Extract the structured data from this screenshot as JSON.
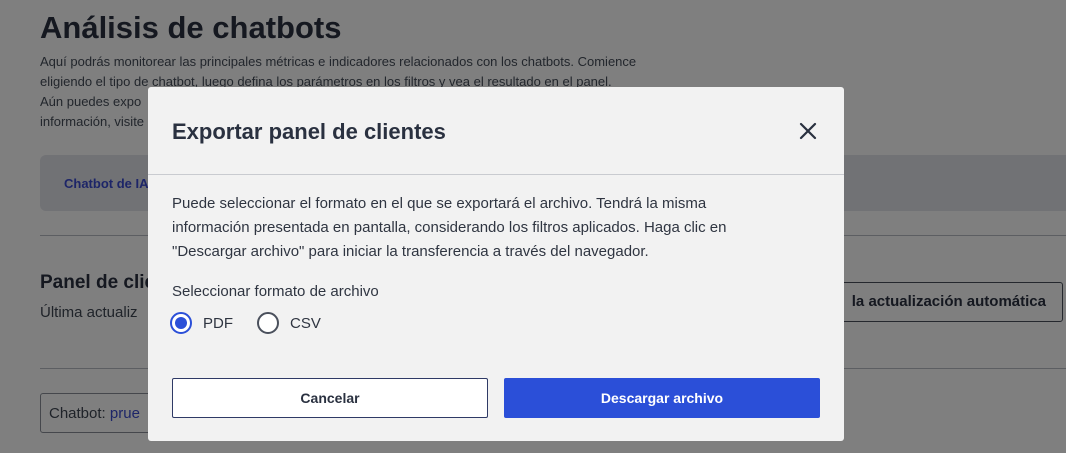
{
  "background": {
    "title": "Análisis de chatbots",
    "description_lines": [
      "Aquí podrás monitorear las principales métricas e indicadores relacionados con los chatbots. Comience",
      "eligiendo el tipo de chatbot, luego defina los parámetros en los filtros y vea el resultado en el panel.",
      "Aún puedes expo",
      "información, visite"
    ],
    "tab_label": "Chatbot de IA",
    "panel_title": "Panel de clie",
    "last_update": "Última actualiz",
    "auto_update_button": "la actualización automática",
    "chatbot_select_label": "Chatbot:",
    "chatbot_select_value": "prue"
  },
  "modal": {
    "title": "Exportar panel de clientes",
    "description_lines": [
      "Puede seleccionar el formato en el que se exportará el archivo. Tendrá la misma",
      "información presentada en pantalla, considerando los filtros aplicados. Haga clic en",
      "\"Descargar archivo\" para iniciar la transferencia a través del navegador."
    ],
    "format_label": "Seleccionar formato de archivo",
    "options": [
      {
        "label": "PDF",
        "selected": true
      },
      {
        "label": "CSV",
        "selected": false
      }
    ],
    "cancel_label": "Cancelar",
    "download_label": "Descargar archivo"
  },
  "colors": {
    "accent": "#2b4fd8",
    "link": "#3a4bd0",
    "overlay": "rgba(0,0,0,0.5)"
  },
  "icons": {
    "close": "close-icon"
  }
}
